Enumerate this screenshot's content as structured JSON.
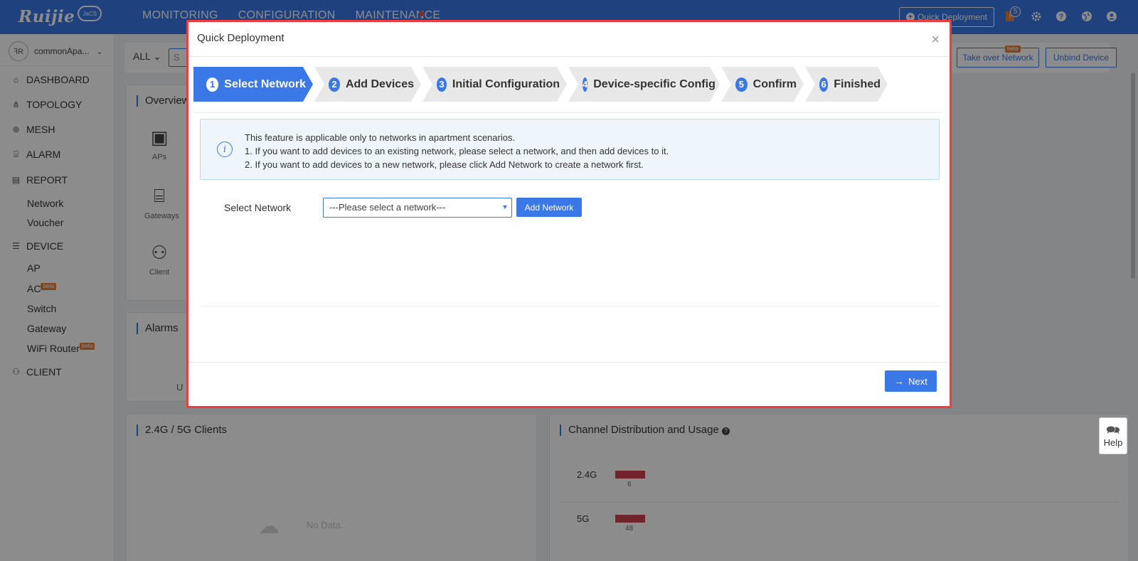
{
  "header": {
    "logo_text": "Ruijie",
    "logo_sub": "JaCS",
    "nav": [
      "MONITORING",
      "CONFIGURATION",
      "MAINTENANCE"
    ],
    "quick_deployment": "Quick Deployment",
    "notification_count": "5"
  },
  "sidebar": {
    "account_name": "commonApa...",
    "account_avatar": "ꟻR",
    "items": [
      {
        "label": "DASHBOARD",
        "icon": "home-icon"
      },
      {
        "label": "TOPOLOGY",
        "icon": "topology-icon"
      },
      {
        "label": "MESH",
        "icon": "mesh-icon"
      },
      {
        "label": "ALARM",
        "icon": "alarm-icon"
      },
      {
        "label": "REPORT",
        "icon": "report-icon"
      },
      {
        "label": "DEVICE",
        "icon": "device-icon"
      },
      {
        "label": "CLIENT",
        "icon": "client-icon"
      }
    ],
    "report_sub": [
      "Network",
      "Voucher"
    ],
    "device_sub": [
      "AP",
      "AC",
      "Switch",
      "Gateway",
      "WiFi Router"
    ],
    "beta": "beta"
  },
  "toolbar": {
    "filter": "ALL",
    "search_placeholder": "S",
    "take_over": "Take over Network",
    "unbind": "Unbind Device",
    "beta": "beta"
  },
  "dashboard": {
    "overview_title": "Overview",
    "overview_items": [
      "APs",
      "Gateways",
      "Client"
    ],
    "alarms_title": "Alarms",
    "alarms_fragment": "U",
    "clients_title": "2.4G / 5G Clients",
    "no_data": "No Data..",
    "channel_title": "Channel Distribution and Usage",
    "channels": [
      {
        "band": "2.4G",
        "value": "6"
      },
      {
        "band": "5G",
        "value": "48"
      }
    ],
    "help": "Help"
  },
  "modal": {
    "title": "Quick Deployment",
    "steps": [
      {
        "num": "1",
        "label": "Select Network"
      },
      {
        "num": "2",
        "label": "Add Devices"
      },
      {
        "num": "3",
        "label": "Initial Configuration"
      },
      {
        "num": "4",
        "label": "Device-specific Config"
      },
      {
        "num": "5",
        "label": "Confirm"
      },
      {
        "num": "6",
        "label": "Finished"
      }
    ],
    "info_lines": [
      "This feature is applicable only to networks in apartment scenarios.",
      "1. If you want to add devices to an existing network, please select a network, and then add devices to it.",
      "2. If you want to add devices to a new network, please click Add Network to create a network first."
    ],
    "select_label": "Select Network",
    "select_value": "---Please select a network---",
    "add_network": "Add Network",
    "next": "Next"
  },
  "colors": {
    "primary": "#3a78e7",
    "modal_border": "#f03c3c",
    "bar": "#cf4250"
  }
}
